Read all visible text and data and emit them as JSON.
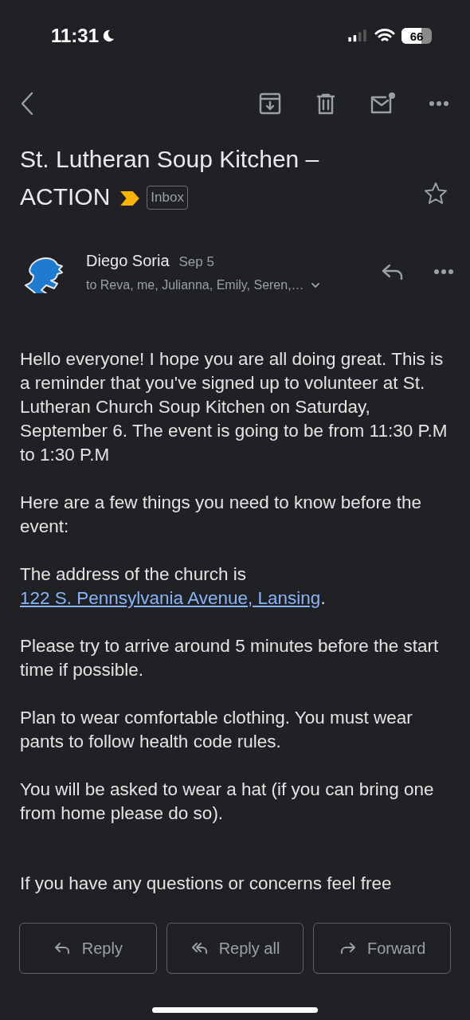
{
  "status_bar": {
    "time": "11:31",
    "battery": "66"
  },
  "subject": {
    "title": "St. Lutheran Soup Kitchen – ACTION",
    "important": true,
    "label": "Inbox",
    "starred": false
  },
  "message": {
    "sender": "Diego Soria",
    "date": "Sep 5",
    "recipients": "to Reva, me, Julianna, Emily, Seren,…"
  },
  "body": [
    {
      "parts": [
        {
          "kind": "text",
          "text": "Hello everyone! I hope you are all doing great. This is a reminder that you've signed up to volunteer at St. Lutheran Church Soup Kitchen on Saturday, September 6. The event is going to be from 11:30 P.M to 1:30 P.M"
        }
      ]
    },
    {
      "parts": [
        {
          "kind": "text",
          "text": "Here are a few things you need to know before the event:"
        }
      ]
    },
    {
      "parts": [
        {
          "kind": "text",
          "text": "The address of the church is "
        },
        {
          "kind": "link",
          "text": "122 S. Pennsylvania Avenue, Lansing"
        },
        {
          "kind": "text",
          "text": "."
        }
      ]
    },
    {
      "parts": [
        {
          "kind": "text",
          "text": "Please try to arrive around 5 minutes before the start time if possible."
        }
      ]
    },
    {
      "parts": [
        {
          "kind": "text",
          "text": "Plan to wear comfortable clothing. You must wear pants to follow health code rules."
        }
      ]
    },
    {
      "parts": [
        {
          "kind": "text",
          "text": "You will be asked to wear a hat (if you can bring one from home please do so)."
        }
      ]
    },
    {
      "parts": [
        {
          "kind": "text",
          "text": "If you have any questions or concerns feel free"
        }
      ]
    }
  ],
  "actions": [
    {
      "kind": "reply",
      "label": "Reply"
    },
    {
      "kind": "reply-all",
      "label": "Reply all"
    },
    {
      "kind": "forward",
      "label": "Forward"
    }
  ]
}
